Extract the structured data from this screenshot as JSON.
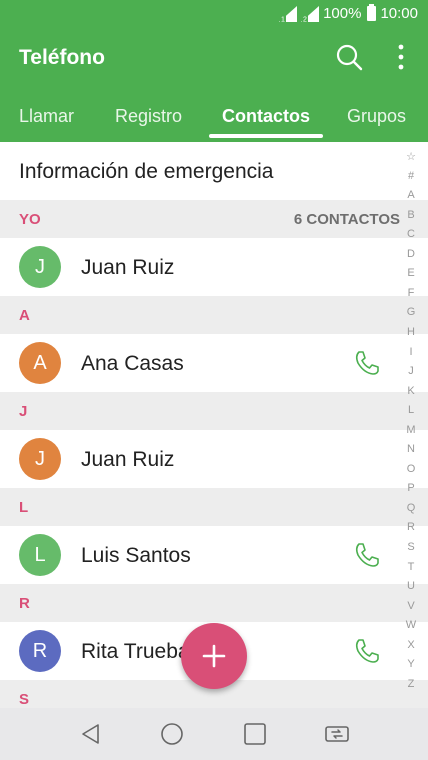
{
  "status_bar": {
    "battery": "100%",
    "time": "10:00",
    "sim_labels": [
      "1",
      "2"
    ]
  },
  "app_bar": {
    "title": "Teléfono",
    "search_icon": "search-icon",
    "more_icon": "more-vert-icon"
  },
  "tabs": [
    {
      "label": "Llamar",
      "active": false
    },
    {
      "label": "Registro",
      "active": false
    },
    {
      "label": "Contactos",
      "active": true
    },
    {
      "label": "Grupos",
      "active": false
    }
  ],
  "emergency_label": "Información de emergencia",
  "sections": [
    {
      "letter": "YO",
      "count": "6 CONTACTOS"
    },
    {
      "letter": "A"
    },
    {
      "letter": "J"
    },
    {
      "letter": "L"
    },
    {
      "letter": "R"
    },
    {
      "letter": "S"
    }
  ],
  "contacts": [
    {
      "initial": "J",
      "name": "Juan Ruiz",
      "color": "#66bb6a",
      "has_call": false
    },
    {
      "initial": "A",
      "name": "Ana Casas",
      "color": "#e0843f",
      "has_call": true
    },
    {
      "initial": "J",
      "name": "Juan Ruiz",
      "color": "#e0843f",
      "has_call": false
    },
    {
      "initial": "L",
      "name": "Luis Santos",
      "color": "#66bb6a",
      "has_call": true
    },
    {
      "initial": "R",
      "name": "Rita Trueba",
      "color": "#5c6bc0",
      "has_call": true
    }
  ],
  "index_letters": [
    "☆",
    "#",
    "A",
    "B",
    "C",
    "D",
    "E",
    "F",
    "G",
    "H",
    "I",
    "J",
    "K",
    "L",
    "M",
    "N",
    "O",
    "P",
    "Q",
    "R",
    "S",
    "T",
    "U",
    "V",
    "W",
    "X",
    "Y",
    "Z"
  ],
  "fab_icon": "add-icon",
  "colors": {
    "primary": "#4caf50",
    "accent": "#d94f77",
    "call_green": "#4caf50"
  },
  "nav_icons": [
    "back-icon",
    "home-icon",
    "recents-icon",
    "dual-window-icon"
  ]
}
